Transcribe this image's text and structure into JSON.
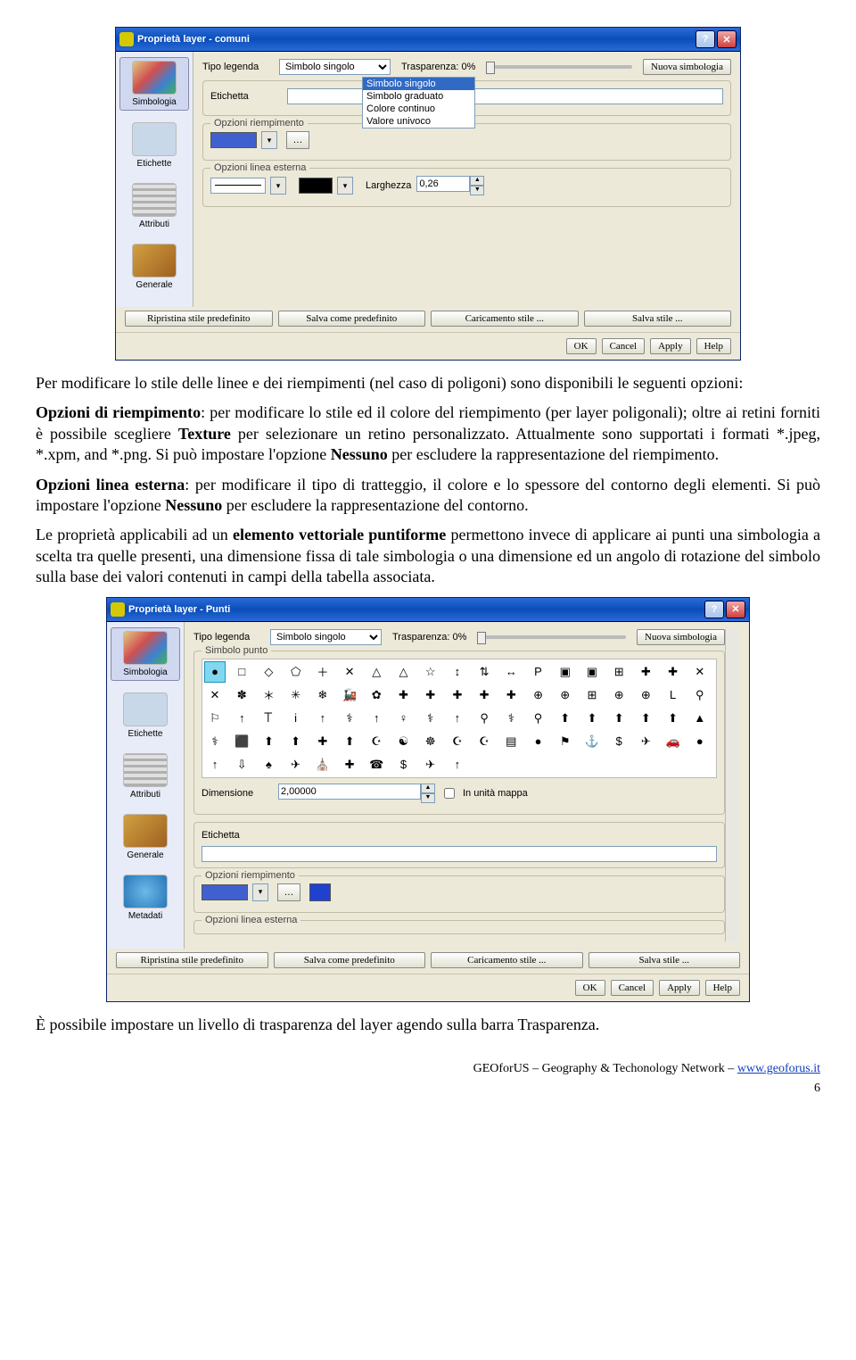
{
  "dialog1": {
    "title": "Proprietà layer - comuni",
    "sidebar": [
      "Simbologia",
      "Etichette",
      "Attributi",
      "Generale"
    ],
    "labels": {
      "tipo": "Tipo legenda",
      "etichetta": "Etichetta",
      "opz_riemp": "Opzioni riempimento",
      "opz_linea": "Opzioni linea esterna",
      "larghezza": "Larghezza",
      "trasp": "Trasparenza: 0%",
      "nuova": "Nuova simbologia"
    },
    "dropdown": {
      "selected": "Simbolo singolo",
      "options": [
        "Simbolo singolo",
        "Simbolo graduato",
        "Colore continuo",
        "Valore univoco"
      ]
    },
    "larghezza_val": "0,26",
    "bottom": [
      "Ripristina stile predefinito",
      "Salva come predefinito",
      "Caricamento stile ...",
      "Salva stile ..."
    ],
    "std": [
      "OK",
      "Cancel",
      "Apply",
      "Help"
    ]
  },
  "para1": {
    "t1": "Per modificare lo stile delle linee e dei riempimenti (nel caso di poligoni) sono disponibili le seguenti opzioni:",
    "t2a": "Opzioni di riempimento",
    "t2b": ": per modificare lo stile ed il colore del riempimento (per layer poligonali); oltre ai retini forniti è possibile scegliere ",
    "t2c": "Texture",
    "t2d": " per selezionare un retino personalizzato. Attualmente sono supportati i formati *.jpeg, *.xpm, and *.png. Si può impostare l'opzione ",
    "t2e": "Nessuno",
    "t2f": " per escludere la rappresentazione del riempimento.",
    "t3a": "Opzioni linea esterna",
    "t3b": ": per modificare il tipo di tratteggio, il colore e lo spessore del contorno degli elementi. Si può impostare l'opzione ",
    "t3c": "Nessuno",
    "t3d": " per escludere la rappresentazione del contorno.",
    "t4a": "Le proprietà applicabili ad un ",
    "t4b": "elemento vettoriale puntiforme",
    "t4c": " permettono invece di applicare ai punti una simbologia a scelta tra quelle presenti, una dimensione fissa di tale simbologia o una dimensione ed un angolo di rotazione del simbolo sulla base dei valori contenuti in campi della tabella associata."
  },
  "dialog2": {
    "title": "Proprietà layer - Punti",
    "sidebar": [
      "Simbologia",
      "Etichette",
      "Attributi",
      "Generale",
      "Metadati"
    ],
    "labels": {
      "tipo": "Tipo legenda",
      "simbolo_punto": "Simbolo punto",
      "dimensione": "Dimensione",
      "in_unita": "In unità mappa",
      "etichetta": "Etichetta",
      "opz_riemp": "Opzioni riempimento",
      "opz_linea": "Opzioni linea esterna",
      "trasp": "Trasparenza: 0%",
      "nuova": "Nuova simbologia"
    },
    "tipo_val": "Simbolo singolo",
    "dim_val": "2,00000",
    "symbols": [
      "●",
      "□",
      "◇",
      "⬠",
      "＋",
      "✕",
      "△",
      "△",
      "☆",
      "↕",
      "⇅",
      "↔",
      "P",
      "▣",
      "▣",
      "⊞",
      "✚",
      "✚",
      "✕",
      "✕",
      "✽",
      "＊",
      "✳",
      "❄",
      "🚂",
      "✿",
      "✚",
      "✚",
      "✚",
      "✚",
      "✚",
      "⊕",
      "⊕",
      "⊞",
      "⊕",
      "⊕",
      "L",
      "⚲",
      "⚐",
      "↑",
      "𐊗",
      "i",
      "↑",
      "⚕",
      "↑",
      "♀",
      "⚕",
      "↑",
      "⚲",
      "⚕",
      "⚲",
      "⬆",
      "⬆",
      "⬆",
      "⬆",
      "⬆",
      "▲",
      "⚕",
      "⬛",
      "⬆",
      "⬆",
      "✚",
      "⬆",
      "☪",
      "☯",
      "☸",
      "☪",
      "☪",
      "▤",
      "●",
      "⚑",
      "⚓",
      "$",
      "✈",
      "🚗",
      "●",
      "↑",
      "⇩",
      "♠",
      "✈",
      "⛪",
      "✚",
      "☎",
      "$",
      "✈",
      "↑"
    ],
    "bottom": [
      "Ripristina stile predefinito",
      "Salva come predefinito",
      "Caricamento stile ...",
      "Salva stile ..."
    ],
    "std": [
      "OK",
      "Cancel",
      "Apply",
      "Help"
    ]
  },
  "para2": "È possibile impostare un livello di trasparenza del layer agendo sulla barra Trasparenza.",
  "footer": {
    "text": "GEOforUS – Geography & Techonology Network – ",
    "link": "www.geoforus.it"
  },
  "page": "6"
}
